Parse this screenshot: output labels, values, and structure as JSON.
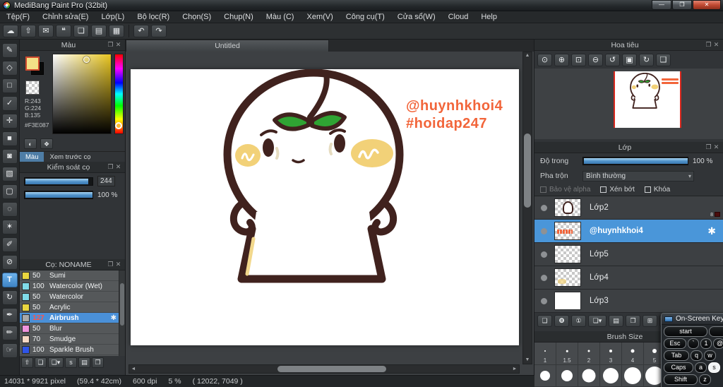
{
  "window": {
    "title": "MediBang Paint Pro (32bit)",
    "minimize_glyph": "—",
    "maximize_glyph": "❐",
    "close_glyph": "✕"
  },
  "menu": {
    "items": [
      "Tệp(F)",
      "Chỉnh sửa(E)",
      "Lớp(L)",
      "Bộ lọc(R)",
      "Chọn(S)",
      "Chụp(N)",
      "Màu (C)",
      "Xem(V)",
      "Công cụ(T)",
      "Cửa sổ(W)",
      "Cloud",
      "Help"
    ]
  },
  "main_toolbar": {
    "buttons": [
      {
        "name": "cloud",
        "glyph": "☁"
      },
      {
        "name": "publish",
        "glyph": "⇧"
      },
      {
        "name": "comment",
        "glyph": "✉"
      },
      {
        "name": "chat",
        "glyph": "❝"
      },
      {
        "name": "document",
        "glyph": "❏"
      },
      {
        "name": "panel-list",
        "glyph": "▤"
      },
      {
        "name": "panel-settings",
        "glyph": "▦"
      }
    ],
    "undo_glyph": "↶",
    "redo_glyph": "↷"
  },
  "tools": [
    {
      "name": "brush",
      "glyph": "✎"
    },
    {
      "name": "eraser",
      "glyph": "◇"
    },
    {
      "name": "shape",
      "glyph": "□"
    },
    {
      "name": "dot-pen",
      "glyph": "✓"
    },
    {
      "name": "move",
      "glyph": "✛"
    },
    {
      "name": "fill-rect",
      "glyph": "■"
    },
    {
      "name": "bucket",
      "glyph": "◙"
    },
    {
      "name": "gradient",
      "glyph": "▧"
    },
    {
      "name": "select-rect",
      "glyph": "▢"
    },
    {
      "name": "lasso",
      "glyph": "◌"
    },
    {
      "name": "magic-wand",
      "glyph": "✶"
    },
    {
      "name": "select-pen",
      "glyph": "✐"
    },
    {
      "name": "select-eraser",
      "glyph": "⊘"
    },
    {
      "name": "text",
      "glyph": "T"
    },
    {
      "name": "operation",
      "glyph": "↻"
    },
    {
      "name": "eyedropper",
      "glyph": "✒"
    },
    {
      "name": "pen",
      "glyph": "✏"
    },
    {
      "name": "hand",
      "glyph": "☞"
    }
  ],
  "color_panel": {
    "title": "Màu",
    "r_label": "R:243",
    "g_label": "G:224",
    "b_label": "B:135",
    "hex": "#F3E087",
    "foreground_color": "#F3E087",
    "palette_glyph": "◐",
    "swap_glyph": "❖",
    "tab_color": "Màu",
    "tab_preview": "Xem trước cọ"
  },
  "brush_control_panel": {
    "title": "Kiểm soát cọ",
    "size_value": "244",
    "opacity_value": "100 %"
  },
  "brush_list_panel": {
    "title": "Cọ: NONAME",
    "gear_glyph": "✱",
    "brushes": [
      {
        "size": "50",
        "name": "Sumi",
        "color": "#e9d53f"
      },
      {
        "size": "100",
        "name": "Watercolor (Wet)",
        "color": "#7fdbe8"
      },
      {
        "size": "50",
        "name": "Watercolor",
        "color": "#7fdbe8"
      },
      {
        "size": "50",
        "name": "Acrylic",
        "color": "#e9d53f"
      },
      {
        "size": "127",
        "name": "Airbrush",
        "color": "#a9a9a9"
      },
      {
        "size": "50",
        "name": "Blur",
        "color": "#ef93dd"
      },
      {
        "size": "70",
        "name": "Smudge",
        "color": "#f6d8c4"
      },
      {
        "size": "100",
        "name": "Sparkle Brush",
        "color": "#2f55e8"
      }
    ],
    "footer_buttons": [
      {
        "name": "upload",
        "glyph": "⇧"
      },
      {
        "name": "new-brush",
        "glyph": "❏"
      },
      {
        "name": "add-brush-menu",
        "glyph": "❏▾"
      },
      {
        "name": "script-brush",
        "glyph": "s"
      },
      {
        "name": "folder",
        "glyph": "▤"
      },
      {
        "name": "duplicate",
        "glyph": "❐"
      }
    ]
  },
  "canvas": {
    "tab_title": "Untitled",
    "watermark_line1": "@huynhkhoi4",
    "watermark_line2": "#hoidap247",
    "watermark_color": "#f2653a"
  },
  "navigator": {
    "title": "Hoa tiêu",
    "buttons": [
      {
        "name": "zoom-actual",
        "glyph": "⊙"
      },
      {
        "name": "zoom-in",
        "glyph": "⊕"
      },
      {
        "name": "fit-screen",
        "glyph": "⊡"
      },
      {
        "name": "zoom-out",
        "glyph": "⊖"
      },
      {
        "name": "rotate-left",
        "glyph": "↺"
      },
      {
        "name": "reset-view",
        "glyph": "▣"
      },
      {
        "name": "rotate-right",
        "glyph": "↻"
      },
      {
        "name": "lock",
        "glyph": "❑"
      }
    ]
  },
  "layers_panel": {
    "title": "Lớp",
    "opacity_label": "Độ trong",
    "opacity_value": "100 %",
    "blend_label": "Pha trộn",
    "blend_value": "Bình thường",
    "check_alpha": "Bảo vệ alpha",
    "check_clip": "Xén bớt",
    "check_lock": "Khóa",
    "gear_glyph": "✱",
    "layers": [
      {
        "name": "Lớp2",
        "badge": "8"
      },
      {
        "name": "@huynhkhoi4"
      },
      {
        "name": "Lớp5"
      },
      {
        "name": "Lớp4"
      },
      {
        "name": "Lớp3"
      }
    ],
    "toolbar_buttons": [
      {
        "name": "new-layer",
        "glyph": "❏"
      },
      {
        "name": "new-8bit-layer",
        "glyph": "❽"
      },
      {
        "name": "new-1bit-layer",
        "glyph": "①"
      },
      {
        "name": "add-layer-menu",
        "glyph": "❏▾"
      },
      {
        "name": "layer-folder",
        "glyph": "▤"
      },
      {
        "name": "duplicate-layer",
        "glyph": "❐"
      },
      {
        "name": "merge-layer",
        "glyph": "⊞"
      },
      {
        "name": "delete-layer",
        "glyph": "✕"
      }
    ]
  },
  "brush_size_panel": {
    "title": "Brush Size",
    "sizes": [
      "1",
      "1.5",
      "2",
      "3",
      "4",
      "5"
    ]
  },
  "on_screen_keyboard": {
    "title": "On-Screen Keybo",
    "rows": [
      {
        "keys": [
          {
            "label": "start"
          },
          {
            "label": "s"
          }
        ]
      },
      {
        "keys": [
          {
            "label": "Esc"
          },
          {
            "label": "`"
          },
          {
            "label": "1"
          },
          {
            "label": "@"
          }
        ]
      },
      {
        "keys": [
          {
            "label": "Tab"
          },
          {
            "label": "q"
          },
          {
            "label": "w"
          }
        ]
      },
      {
        "keys": [
          {
            "label": "Caps"
          },
          {
            "label": "a"
          },
          {
            "label": "s"
          }
        ]
      },
      {
        "keys": [
          {
            "label": "Shift"
          },
          {
            "label": "z"
          }
        ]
      }
    ]
  },
  "status_bar": {
    "size": "14031 * 9921 pixel",
    "dimensions": "(59.4 * 42cm)",
    "dpi": "600 dpi",
    "zoom": "5 %",
    "coords": "( 12022, 7049 )"
  }
}
